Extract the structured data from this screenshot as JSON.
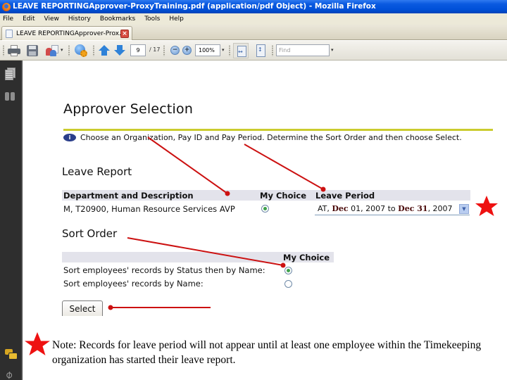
{
  "window": {
    "title": "LEAVE REPORTINGApprover-ProxyTraining.pdf (application/pdf Object) - Mozilla Firefox"
  },
  "menu": {
    "items": [
      "File",
      "Edit",
      "View",
      "History",
      "Bookmarks",
      "Tools",
      "Help"
    ]
  },
  "tabs": [
    {
      "label": "LEAVE REPORTINGApprover-Prox..."
    }
  ],
  "pdf_toolbar": {
    "page_current": "9",
    "page_total": "/ 17",
    "zoom_value": "100%",
    "zoom_out_symbol": "−",
    "zoom_in_symbol": "+",
    "find_placeholder": "Find",
    "dropdown_symbol": "▾"
  },
  "sidebar": {
    "icons": [
      "pages-icon",
      "binoculars-icon",
      "comments-icon",
      "paperclip-icon"
    ]
  },
  "document": {
    "heading": "Approver Selection",
    "info_icon_symbol": "i",
    "instructions": "Choose an Organization, Pay ID and Pay Period. Determine the Sort Order and then choose Select.",
    "leave_report": {
      "heading": "Leave Report",
      "columns": [
        "Department and Description",
        "My Choice",
        "Leave Period"
      ],
      "row": {
        "department": "M, T20900, Human Resource Services AVP",
        "my_choice_selected": true,
        "leave_period": {
          "prefix": "AT, ",
          "start_month": "Dec",
          "start_rest": " 01, 2007 to ",
          "end_month": "Dec",
          "end_day": " 31",
          "end_rest": ", 2007"
        }
      }
    },
    "sort_order": {
      "heading": "Sort Order",
      "column": "My Choice",
      "options": [
        {
          "label": "Sort employees' records by Status then by Name:",
          "selected": true
        },
        {
          "label": "Sort employees' records by Name:",
          "selected": false
        }
      ]
    },
    "select_button": "Select",
    "note": "Note:  Records for leave period will not appear until at least one employee within the Timekeeping organization has started their leave report."
  },
  "annotations": {
    "arrow_color": "#cc1111",
    "star_color": "#ee1111"
  }
}
